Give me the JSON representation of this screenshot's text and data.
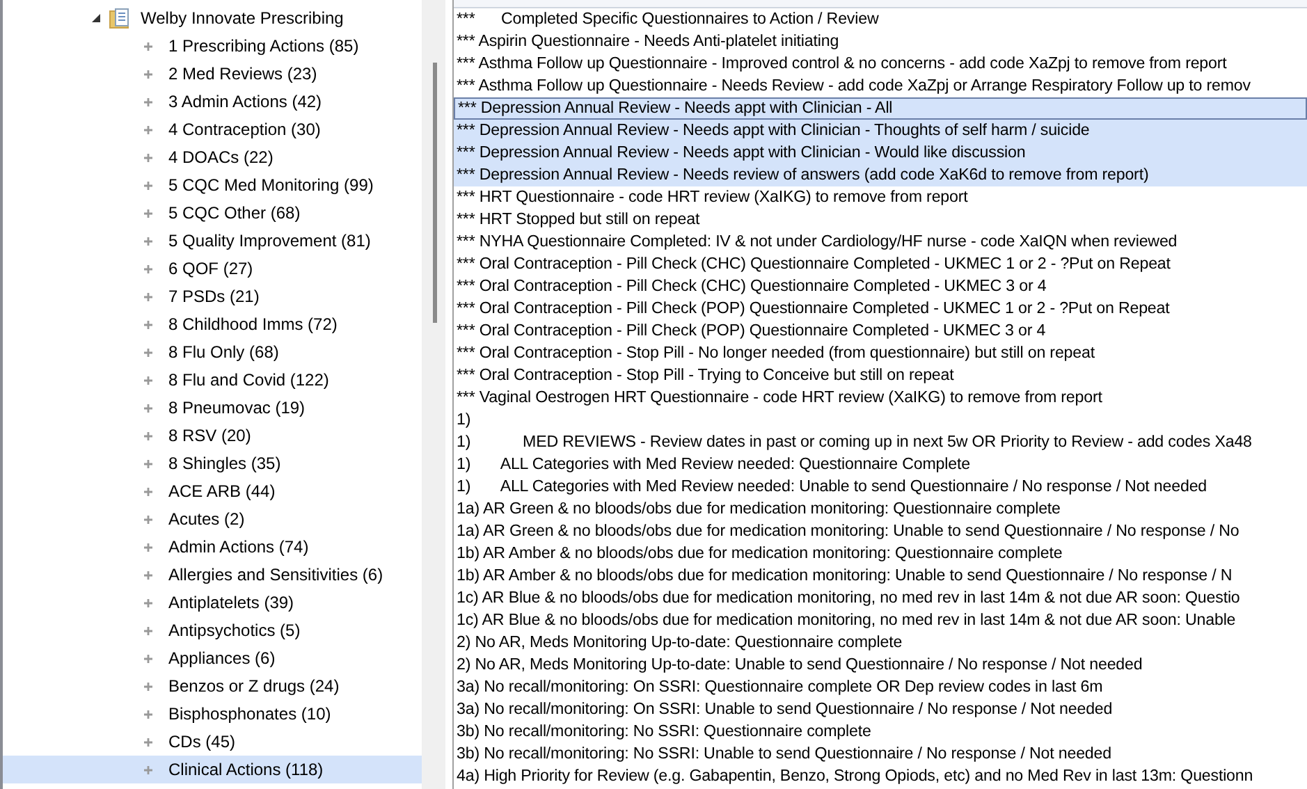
{
  "tree": {
    "root": {
      "label": "Welby Innovate Prescribing",
      "expanded": true,
      "children": [
        {
          "label": "1 Prescribing Actions (85)",
          "selected": false
        },
        {
          "label": "2 Med Reviews (23)",
          "selected": false
        },
        {
          "label": "3 Admin Actions (42)",
          "selected": false
        },
        {
          "label": "4 Contraception (30)",
          "selected": false
        },
        {
          "label": "4 DOACs (22)",
          "selected": false
        },
        {
          "label": "5 CQC Med Monitoring (99)",
          "selected": false
        },
        {
          "label": "5 CQC Other (68)",
          "selected": false
        },
        {
          "label": "5 Quality Improvement (81)",
          "selected": false
        },
        {
          "label": "6 QOF (27)",
          "selected": false
        },
        {
          "label": "7 PSDs (21)",
          "selected": false
        },
        {
          "label": "8 Childhood Imms (72)",
          "selected": false
        },
        {
          "label": "8 Flu Only (68)",
          "selected": false
        },
        {
          "label": "8 Flu and Covid (122)",
          "selected": false
        },
        {
          "label": "8 Pneumovac (19)",
          "selected": false
        },
        {
          "label": "8 RSV (20)",
          "selected": false
        },
        {
          "label": "8 Shingles (35)",
          "selected": false
        },
        {
          "label": "ACE ARB (44)",
          "selected": false
        },
        {
          "label": "Acutes (2)",
          "selected": false
        },
        {
          "label": "Admin Actions (74)",
          "selected": false
        },
        {
          "label": "Allergies and Sensitivities (6)",
          "selected": false
        },
        {
          "label": "Antiplatelets (39)",
          "selected": false
        },
        {
          "label": "Antipsychotics (5)",
          "selected": false
        },
        {
          "label": "Appliances (6)",
          "selected": false
        },
        {
          "label": "Benzos or Z drugs (24)",
          "selected": false
        },
        {
          "label": "Bisphosphonates (10)",
          "selected": false
        },
        {
          "label": "CDs (45)",
          "selected": false
        },
        {
          "label": "Clinical Actions (118)",
          "selected": true
        }
      ]
    }
  },
  "list": {
    "rows": [
      {
        "name": "***      Completed Specific Questionnaires to Action / Review",
        "selected": false,
        "focused": false
      },
      {
        "name": "*** Aspirin Questionnaire - Needs Anti-platelet initiating",
        "selected": false,
        "focused": false
      },
      {
        "name": "*** Asthma Follow up Questionnaire - Improved control & no concerns - add code XaZpj to remove from report",
        "selected": false,
        "focused": false
      },
      {
        "name": "*** Asthma Follow up Questionnaire - Needs Review - add code XaZpj or Arrange Respiratory Follow up to remov",
        "selected": false,
        "focused": false
      },
      {
        "name": "*** Depression Annual Review - Needs appt with Clinician - All",
        "selected": true,
        "focused": true
      },
      {
        "name": "*** Depression Annual Review - Needs appt with Clinician - Thoughts of self harm / suicide",
        "selected": true,
        "focused": false
      },
      {
        "name": "*** Depression Annual Review - Needs appt with Clinician - Would like discussion",
        "selected": true,
        "focused": false
      },
      {
        "name": "*** Depression Annual Review - Needs review of answers (add code XaK6d to remove from report)",
        "selected": true,
        "focused": false
      },
      {
        "name": "*** HRT Questionnaire - code HRT review (XaIKG) to remove from report",
        "selected": false,
        "focused": false
      },
      {
        "name": "*** HRT Stopped but still on repeat",
        "selected": false,
        "focused": false
      },
      {
        "name": "*** NYHA Questionnaire Completed: IV & not under Cardiology/HF nurse - code XaIQN when reviewed",
        "selected": false,
        "focused": false
      },
      {
        "name": "*** Oral Contraception - Pill Check (CHC) Questionnaire Completed - UKMEC 1 or 2 - ?Put on Repeat",
        "selected": false,
        "focused": false
      },
      {
        "name": "*** Oral Contraception - Pill Check (CHC) Questionnaire Completed - UKMEC 3 or 4",
        "selected": false,
        "focused": false
      },
      {
        "name": "*** Oral Contraception - Pill Check (POP) Questionnaire Completed - UKMEC 1 or 2 - ?Put on Repeat",
        "selected": false,
        "focused": false
      },
      {
        "name": "*** Oral Contraception - Pill Check (POP) Questionnaire Completed - UKMEC 3 or 4",
        "selected": false,
        "focused": false
      },
      {
        "name": "*** Oral Contraception - Stop Pill - No longer needed (from questionnaire) but still on repeat",
        "selected": false,
        "focused": false
      },
      {
        "name": "*** Oral Contraception - Stop Pill - Trying to Conceive but still on repeat",
        "selected": false,
        "focused": false
      },
      {
        "name": "*** Vaginal Oestrogen HRT Questionnaire - code HRT review (XaIKG) to remove from report",
        "selected": false,
        "focused": false
      },
      {
        "name": "1)",
        "selected": false,
        "focused": false
      },
      {
        "name": "1)            MED REVIEWS - Review dates in past or coming up in next 5w OR Priority to Review - add codes Xa48",
        "selected": false,
        "focused": false
      },
      {
        "name": "1)       ALL Categories with Med Review needed: Questionnaire Complete",
        "selected": false,
        "focused": false
      },
      {
        "name": "1)       ALL Categories with Med Review needed: Unable to send Questionnaire / No response / Not needed",
        "selected": false,
        "focused": false
      },
      {
        "name": "1a) AR Green & no bloods/obs due for medication monitoring: Questionnaire complete",
        "selected": false,
        "focused": false
      },
      {
        "name": "1a) AR Green & no bloods/obs due for medication monitoring: Unable to send Questionnaire / No response / No",
        "selected": false,
        "focused": false
      },
      {
        "name": "1b) AR Amber & no bloods/obs due for medication monitoring: Questionnaire complete",
        "selected": false,
        "focused": false
      },
      {
        "name": "1b) AR Amber & no bloods/obs due for medication monitoring: Unable to send Questionnaire / No response / N",
        "selected": false,
        "focused": false
      },
      {
        "name": "1c) AR Blue & no bloods/obs due for medication monitoring, no med rev in last 14m & not due AR soon: Questio",
        "selected": false,
        "focused": false
      },
      {
        "name": "1c) AR Blue & no bloods/obs due for medication monitoring, no med rev in last 14m & not due AR soon: Unable",
        "selected": false,
        "focused": false
      },
      {
        "name": "2) No AR, Meds Monitoring Up-to-date: Questionnaire complete",
        "selected": false,
        "focused": false
      },
      {
        "name": "2) No AR, Meds Monitoring Up-to-date: Unable to send Questionnaire / No response / Not needed",
        "selected": false,
        "focused": false
      },
      {
        "name": "3a) No recall/monitoring: On SSRI: Questionnaire complete OR Dep review codes in last 6m",
        "selected": false,
        "focused": false
      },
      {
        "name": "3a) No recall/monitoring: On SSRI: Unable to send Questionnaire / No response / Not needed",
        "selected": false,
        "focused": false
      },
      {
        "name": "3b) No recall/monitoring: No SSRI: Questionnaire complete",
        "selected": false,
        "focused": false
      },
      {
        "name": "3b) No recall/monitoring: No SSRI: Unable to send Questionnaire / No response / Not needed",
        "selected": false,
        "focused": false
      },
      {
        "name": "4a) High Priority for Review (e.g. Gabapentin, Benzo, Strong Opiods, etc) and no Med Rev in last 13m: Questionn",
        "selected": false,
        "focused": false
      }
    ]
  }
}
